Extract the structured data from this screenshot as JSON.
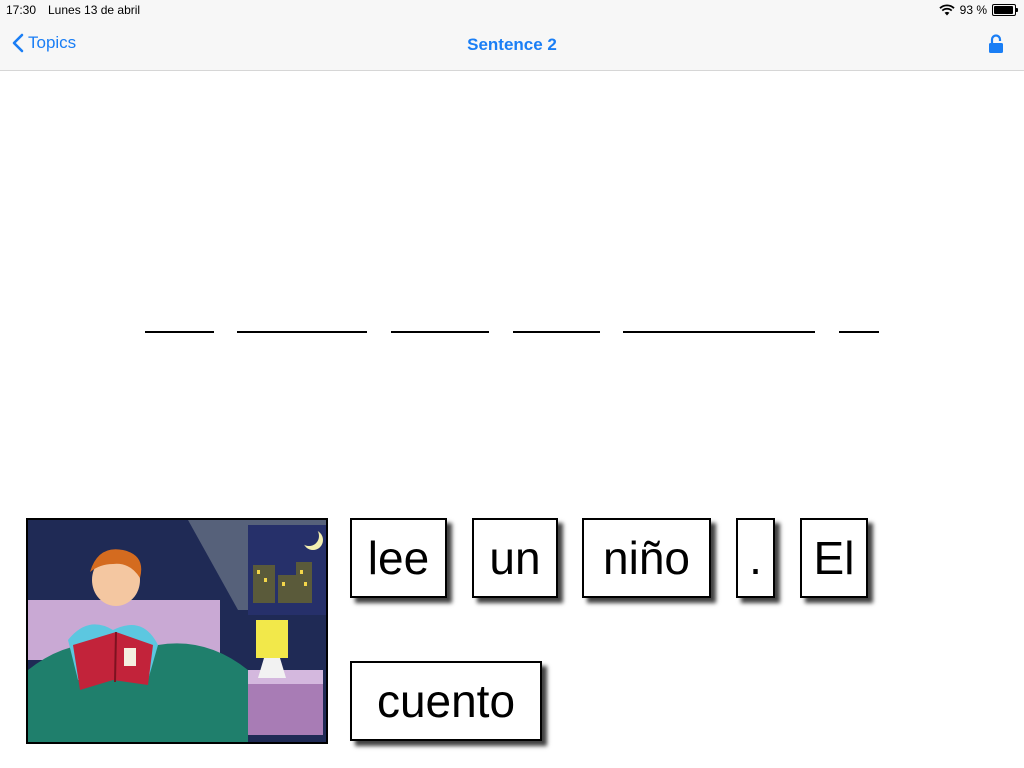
{
  "status_bar": {
    "time": "17:30",
    "date": "Lunes 13 de abril",
    "battery": "93 %",
    "battery_level": 0.93,
    "icons": [
      "wifi-icon",
      "battery-icon"
    ]
  },
  "nav": {
    "back_label": "Topics",
    "title": "Sentence 2",
    "icons": [
      "chevron-left-icon",
      "lock-icon"
    ],
    "accent_color": "#1a7ef5"
  },
  "sentence_slots": 6,
  "picture": {
    "subject": "child-reading-book-in-bed-illustration"
  },
  "word_tiles": [
    {
      "word": "lee"
    },
    {
      "word": "un"
    },
    {
      "word": "niño"
    },
    {
      "word": "."
    },
    {
      "word": "El"
    },
    {
      "word": "cuento"
    }
  ]
}
